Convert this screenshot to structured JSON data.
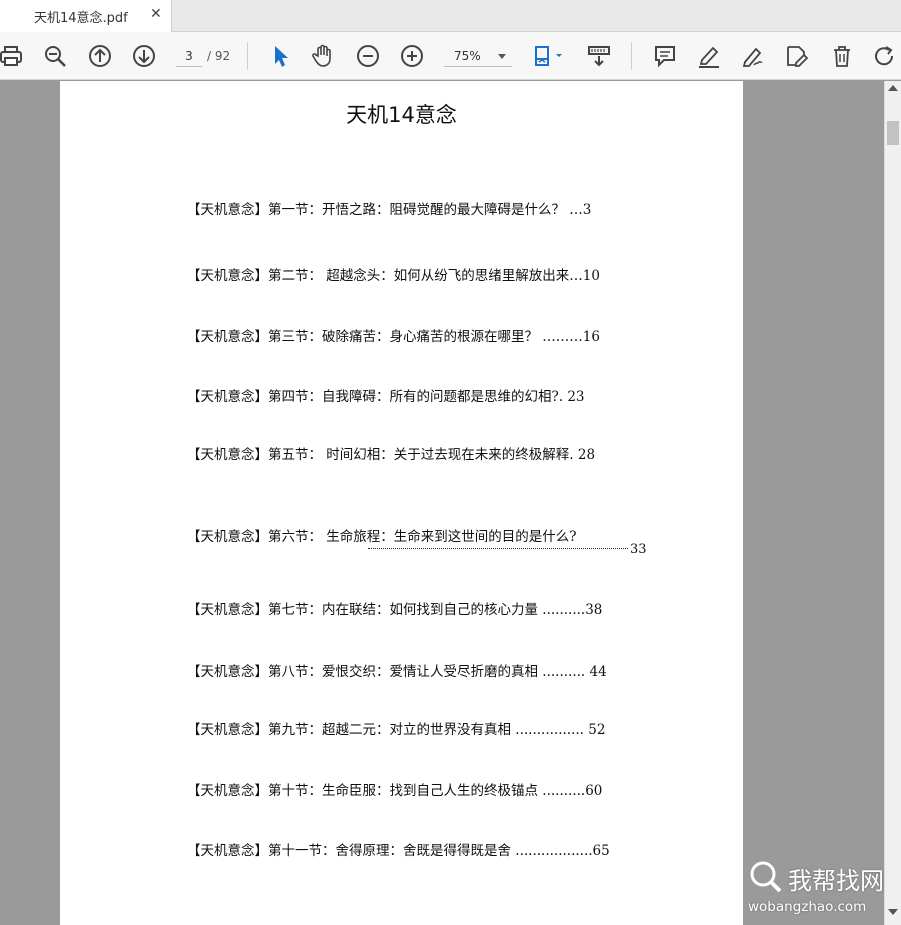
{
  "tab": {
    "title": "天机14意念.pdf",
    "close": "✕"
  },
  "toolbar": {
    "page_current": "3",
    "page_total": "/ 92",
    "zoom": "75%",
    "icons": [
      "print-icon",
      "zoom-out-search-icon",
      "prev-page-icon",
      "next-page-icon",
      "select-cursor-icon",
      "hand-tool-icon",
      "zoom-out-icon",
      "zoom-in-icon",
      "fit-page-icon",
      "scroll-mode-icon",
      "comment-icon",
      "highlight-icon",
      "sign-icon",
      "edit-icon",
      "delete-icon",
      "rotate-icon"
    ]
  },
  "document": {
    "title": "天机14意念",
    "toc": [
      {
        "text": "【天机意念】第一节：开悟之路：阻碍觉醒的最大障碍是什么？ …3"
      },
      {
        "text": "【天机意念】第二节：     超越念头：如何从纷飞的思绪里解放出来…10"
      },
      {
        "text": "【天机意念】第三节：破除痛苦：身心痛苦的根源在哪里？ ………16"
      },
      {
        "text": "【天机意念】第四节：自我障碍：所有的问题都是思维的幻相?.  23"
      },
      {
        "text": "【天机意念】第五节：     时间幻相：关于过去现在未来的终极解释. 28"
      },
      {
        "text": "【天机意念】第六节：     生命旅程：生命来到这世间的目的是什么?"
      },
      {
        "text": "【天机意念】第七节：内在联结：如何找到自己的核心力量 ..........38"
      },
      {
        "text": "【天机意念】第八节：爱恨交织：爱情让人受尽折磨的真相 .......... 44"
      },
      {
        "text": "【天机意念】第九节：超越二元：对立的世界没有真相 ................ 52"
      },
      {
        "text": "【天机意念】第十节：生命臣服：找到自己人生的终极锚点 ..........60"
      },
      {
        "text": "【天机意念】第十一节：舍得原理：舍既是得得既是舍 ..................65"
      }
    ],
    "toc6_page": "33"
  },
  "watermark": {
    "main": "我帮找网",
    "sub": "wobangzhao.com"
  },
  "colors": {
    "accent": "#1a73c9",
    "page_bg": "#ffffff",
    "viewer_bg": "#9a9a9a"
  }
}
